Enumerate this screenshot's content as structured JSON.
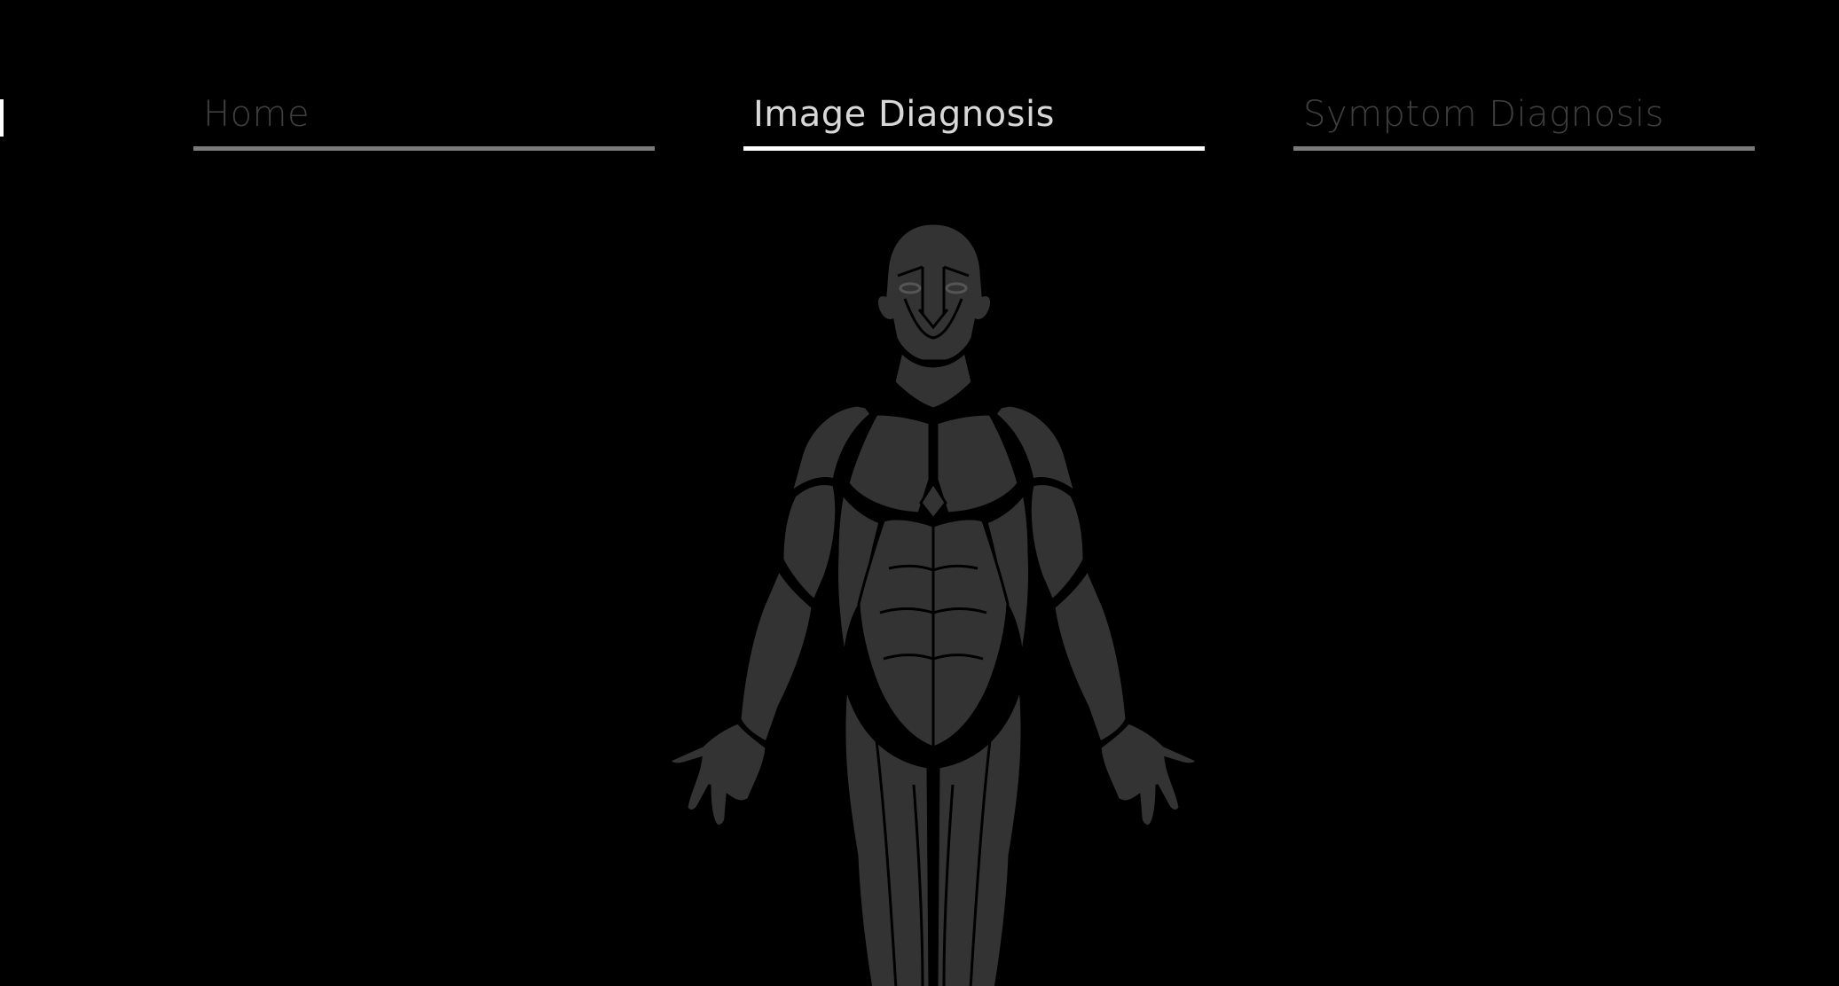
{
  "nav": {
    "tabs": [
      {
        "label": "Home",
        "active": false
      },
      {
        "label": "Image Diagnosis",
        "active": true
      },
      {
        "label": "Symptom Diagnosis",
        "active": false
      }
    ]
  },
  "colors": {
    "background": "#000000",
    "active_tab_text": "#d8d8d8",
    "active_tab_underline": "#ffffff",
    "inactive_tab_text": "#3f3f3f",
    "inactive_tab_underline": "#7a7a7a",
    "body_muscle": "#333333"
  },
  "body_map": {
    "icon": "human-anatomy-figure"
  }
}
